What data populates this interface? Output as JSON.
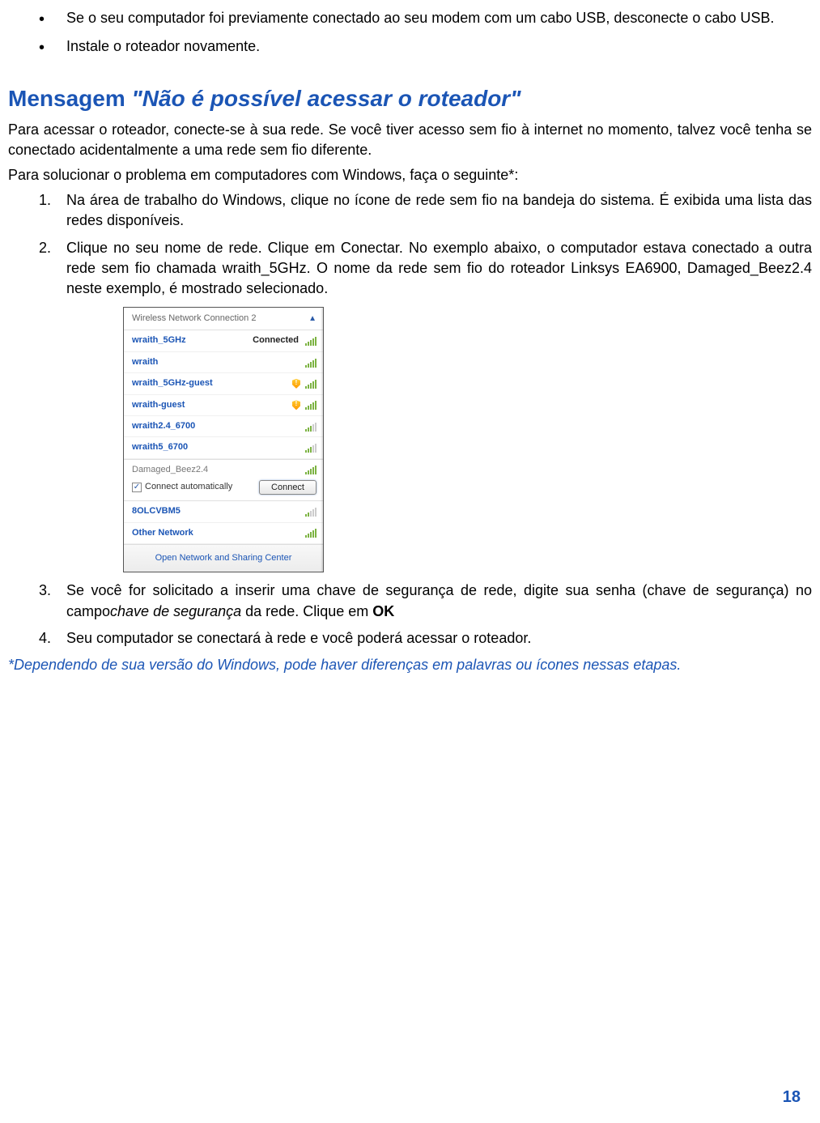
{
  "intro_bullets": [
    "Se o seu computador foi previamente conectado ao seu modem com um cabo USB, desconecte o cabo USB.",
    "Instale o roteador novamente."
  ],
  "heading": {
    "plain": "Mensagem ",
    "italic": "\"Não é possível acessar o roteador\""
  },
  "para1": "Para acessar o roteador, conecte-se à sua rede. Se você tiver acesso sem fio à internet no momento, talvez você tenha se conectado acidentalmente a uma rede sem fio diferente.",
  "para2": "Para solucionar o problema em computadores com Windows, faça o seguinte*:",
  "steps": {
    "s1": "Na área de trabalho do Windows, clique no ícone de rede sem fio na bandeja do sistema. É exibida uma lista das redes disponíveis.",
    "s2": "Clique no seu nome de rede. Clique em Conectar. No exemplo abaixo, o computador estava conectado a outra rede sem fio chamada wraith_5GHz. O nome da rede sem fio do roteador Linksys EA6900, Damaged_Beez2.4 neste exemplo, é mostrado selecionado.",
    "s3_a": "Se você for solicitado a inserir uma chave de segurança de rede, digite sua senha (chave de segurança) no campo",
    "s3_i": "chave de segurança",
    "s3_b": " da rede. Clique em ",
    "s3_bold": "OK",
    "s4": "Seu computador se conectará à rede e você poderá acessar o roteador."
  },
  "wifi": {
    "header": "Wireless Network Connection 2",
    "rows": {
      "r1_name": "wraith_5GHz",
      "r1_status": "Connected",
      "r2": "wraith",
      "r3": "wraith_5GHz-guest",
      "r4": "wraith-guest",
      "r5": "wraith2.4_6700",
      "r6": "wraith5_6700",
      "sel": "Damaged_Beez2.4",
      "auto": "Connect automatically",
      "connect": "Connect",
      "r7": "8OLCVBM5",
      "r8": "Other Network"
    },
    "footer": "Open Network and Sharing Center"
  },
  "footnote": "*Dependendo de sua versão do Windows, pode haver diferenças em palavras ou ícones nessas etapas.",
  "page_number": "18"
}
